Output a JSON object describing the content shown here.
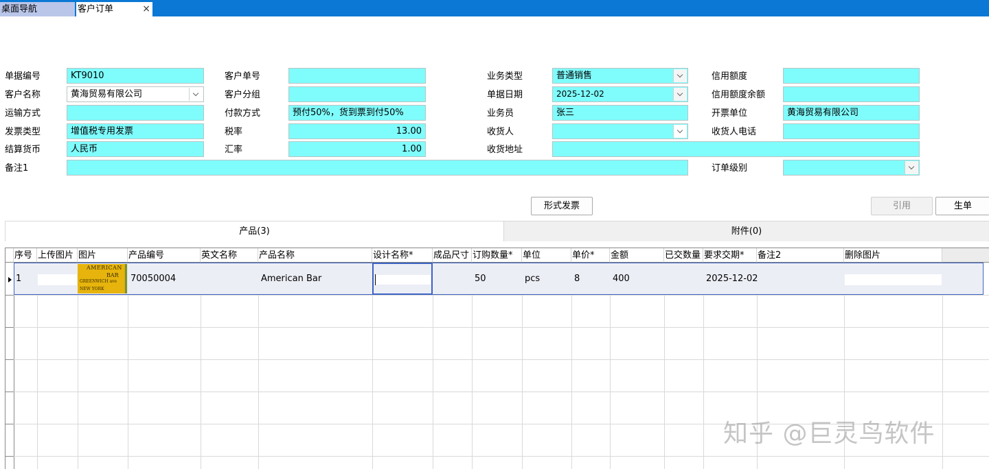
{
  "tabs": {
    "home_label": "桌面导航",
    "active_label": "客户订单",
    "close_glyph": "×"
  },
  "form": {
    "doc_no": {
      "label": "单据编号",
      "value": "KT9010"
    },
    "customer_order_no": {
      "label": "客户单号",
      "value": ""
    },
    "business_type": {
      "label": "业务类型",
      "value": "普通销售"
    },
    "credit_limit": {
      "label": "信用额度",
      "value": ""
    },
    "customer_name": {
      "label": "客户名称",
      "value": "黄海贸易有限公司"
    },
    "customer_group": {
      "label": "客户分组",
      "value": ""
    },
    "doc_date": {
      "label": "单据日期",
      "value": "2025-12-02"
    },
    "credit_balance": {
      "label": "信用额度余额",
      "value": ""
    },
    "shipping_method": {
      "label": "运输方式",
      "value": ""
    },
    "payment_method": {
      "label": "付款方式",
      "value": "预付50%，货到票到付50%"
    },
    "salesperson": {
      "label": "业务员",
      "value": "张三"
    },
    "invoice_unit": {
      "label": "开票单位",
      "value": "黄海贸易有限公司"
    },
    "invoice_type": {
      "label": "发票类型",
      "value": "增值税专用发票"
    },
    "tax_rate": {
      "label": "税率",
      "value": "13.00"
    },
    "consignee": {
      "label": "收货人",
      "value": ""
    },
    "consignee_phone": {
      "label": "收货人电话",
      "value": ""
    },
    "currency": {
      "label": "结算货币",
      "value": "人民币"
    },
    "exchange_rate": {
      "label": "汇率",
      "value": "1.00"
    },
    "delivery_address": {
      "label": "收货地址",
      "value": ""
    },
    "remark1": {
      "label": "备注1",
      "value": ""
    },
    "order_level": {
      "label": "订单级别",
      "value": ""
    }
  },
  "buttons": {
    "proforma": "形式发票",
    "quote": "引用",
    "generate": "生单"
  },
  "subtabs": {
    "products": "产品(3)",
    "attachments": "附件(0)"
  },
  "grid": {
    "columns": [
      "序号",
      "上传图片",
      "图片",
      "产品编号",
      "英文名称",
      "产品名称",
      "设计名称*",
      "成品尺寸",
      "订购数量*",
      "单位",
      "单价*",
      "金额",
      "已交数量",
      "要求交期*",
      "备注2",
      "删除图片"
    ],
    "rows": [
      {
        "seq": "1",
        "upload_image": "",
        "image_text": {
          "line1": "AMERICAN",
          "line2": "BAR",
          "line3": "GREENWICH ave",
          "line4": "NEW YORK"
        },
        "product_code": "70050004",
        "english_name": "",
        "product_name": "American Bar",
        "design_name": "",
        "finished_size": "",
        "quantity": "50",
        "unit": "pcs",
        "unit_price": "8",
        "amount": "400",
        "delivered_qty": "",
        "required_date": "2025-12-02",
        "remark2": "",
        "delete_image": ""
      }
    ]
  },
  "watermark": "知乎 @巨灵鸟软件"
}
